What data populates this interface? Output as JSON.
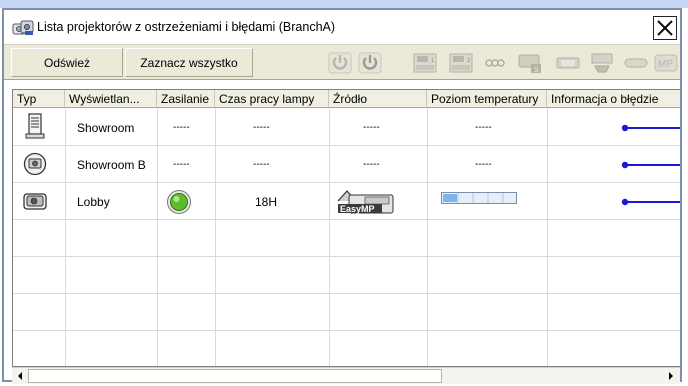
{
  "window": {
    "title": "Lista projektorów z ostrzeżeniami i błędami (BranchA)",
    "close_glyph": "X"
  },
  "toolbar": {
    "refresh_label": "Odśwież",
    "select_all_label": "Zaznacz wszystko",
    "icons": [
      "power-on-icon",
      "power-off-icon",
      "computer1-source-icon",
      "computer2-source-icon",
      "video-source-icon",
      "svideo-source-icon",
      "easymp-source-icon",
      "av-mute-icon",
      "freeze-icon",
      "mp-source-icon"
    ],
    "mp_label": "MP"
  },
  "table": {
    "columns": [
      "Typ",
      "Wyświetlan...",
      "Zasilanie",
      "Czas pracy lampy",
      "Źródło",
      "Poziom temperatury",
      "Informacja o błędzie"
    ],
    "rows": [
      {
        "type_icon": "tower-projector-icon",
        "name": "Showroom",
        "power": "-----",
        "lamp": "-----",
        "source": "-----",
        "temp": "-----",
        "temp_level": null,
        "power_on": false,
        "source_badge": null
      },
      {
        "type_icon": "ceiling-projector-icon",
        "name": "Showroom B",
        "power": "-----",
        "lamp": "-----",
        "source": "-----",
        "temp": "-----",
        "temp_level": null,
        "power_on": false,
        "source_badge": null
      },
      {
        "type_icon": "desk-projector-icon",
        "name": "Lobby",
        "power": "",
        "lamp": "18H",
        "source": "",
        "temp": "",
        "temp_level": 0.2,
        "power_on": true,
        "source_badge": "EasyMP"
      }
    ]
  },
  "colors": {
    "accent_line": "#1a1ad6",
    "window_border": "#7f8daf",
    "toolbar_bg": "#ece9d8",
    "power_green": "#5dbb2c"
  }
}
